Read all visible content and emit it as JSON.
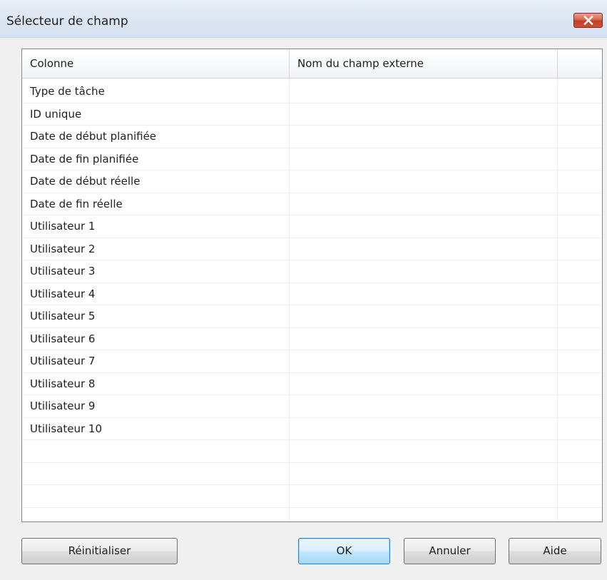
{
  "window": {
    "title": "Sélecteur de champ"
  },
  "icons": {
    "close": "close-icon"
  },
  "colors": {
    "close_button": "#c9533a",
    "default_button_border": "#3c7fb1",
    "grid_border": "#828790"
  },
  "grid": {
    "columns": [
      "Colonne",
      "Nom du champ externe",
      ""
    ],
    "rows": [
      [
        "Type de tâche",
        ""
      ],
      [
        "ID unique",
        ""
      ],
      [
        "Date de début planifiée",
        ""
      ],
      [
        "Date de fin planifiée",
        ""
      ],
      [
        "Date de début réelle",
        ""
      ],
      [
        "Date de fin réelle",
        ""
      ],
      [
        "Utilisateur 1",
        ""
      ],
      [
        "Utilisateur 2",
        ""
      ],
      [
        "Utilisateur 3",
        ""
      ],
      [
        "Utilisateur 4",
        ""
      ],
      [
        "Utilisateur 5",
        ""
      ],
      [
        "Utilisateur 6",
        ""
      ],
      [
        "Utilisateur 7",
        ""
      ],
      [
        "Utilisateur 8",
        ""
      ],
      [
        "Utilisateur 9",
        ""
      ],
      [
        "Utilisateur 10",
        ""
      ],
      [
        "",
        ""
      ],
      [
        "",
        ""
      ],
      [
        "",
        ""
      ],
      [
        "",
        ""
      ]
    ]
  },
  "buttons": {
    "reset": "Réinitialiser",
    "ok": "OK",
    "cancel": "Annuler",
    "help": "Aide"
  }
}
